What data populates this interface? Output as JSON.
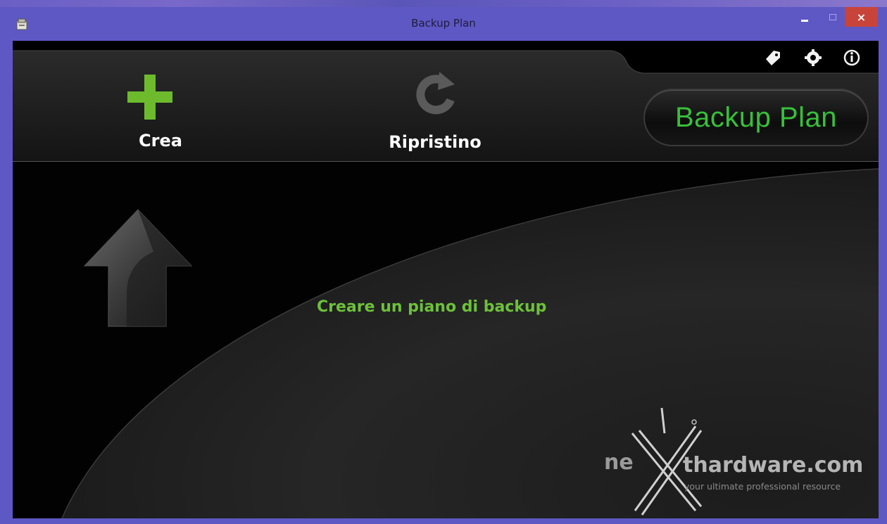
{
  "window": {
    "title": "Backup Plan",
    "close_glyph": "×"
  },
  "toolbar": {
    "crea_label": "Crea",
    "ripristino_label": "Ripristino"
  },
  "brand": {
    "text": "Backup Plan"
  },
  "main": {
    "hint_text": "Creare un piano di backup"
  },
  "watermark": {
    "prefix": "ne",
    "brand": "thardware.com",
    "tagline": "your ultimate professional resource"
  },
  "icons": {
    "top_right": [
      "tag-icon",
      "gear-icon",
      "info-icon"
    ],
    "crea": "plus-icon",
    "ripristino": "refresh-icon",
    "hint": "up-arrow-icon"
  },
  "colors": {
    "accent_green": "#6dbb2d",
    "brand_green": "#38c03a",
    "title_bar": "#5e58c4",
    "close_button": "#c8443a"
  }
}
